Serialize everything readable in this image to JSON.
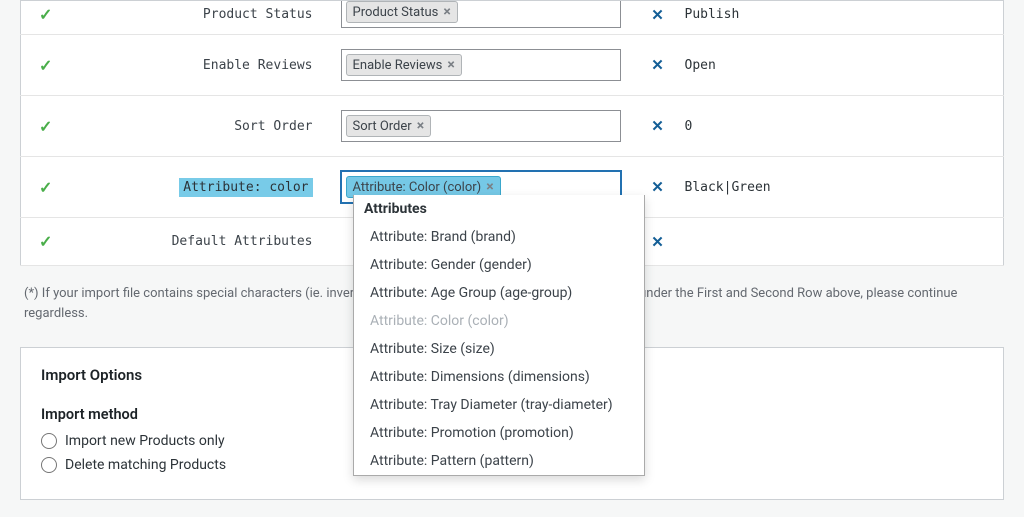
{
  "rows": [
    {
      "label": "Product Status",
      "chip": "Product Status",
      "value": "Publish",
      "highlighted": false,
      "clipped": true
    },
    {
      "label": "Enable Reviews",
      "chip": "Enable Reviews",
      "value": "Open",
      "highlighted": false,
      "clipped": false
    },
    {
      "label": "Sort Order",
      "chip": "Sort Order",
      "value": "0",
      "highlighted": false,
      "clipped": false
    },
    {
      "label": "Attribute: color",
      "chip": "Attribute: Color (color)",
      "value": "Black|Green",
      "highlighted": true,
      "clipped": false
    },
    {
      "label": "Default Attributes",
      "chip": "",
      "value": "",
      "highlighted": false,
      "clipped": false
    }
  ],
  "footer_note": "(*) If your import file contains special characters (ie. inverted commas, exclamation marks) that look weird under the First and Second Row above, please continue regardless.",
  "options": {
    "title": "Import Options",
    "method_title": "Import method",
    "method_options": [
      "Import new Products only",
      "Delete matching Products"
    ]
  },
  "dropdown": {
    "group": "Attributes",
    "items": [
      {
        "label": "Attribute: Brand (brand)",
        "disabled": false
      },
      {
        "label": "Attribute: Gender (gender)",
        "disabled": false
      },
      {
        "label": "Attribute: Age Group (age-group)",
        "disabled": false
      },
      {
        "label": "Attribute: Color (color)",
        "disabled": true
      },
      {
        "label": "Attribute: Size (size)",
        "disabled": false
      },
      {
        "label": "Attribute: Dimensions (dimensions)",
        "disabled": false
      },
      {
        "label": "Attribute: Tray Diameter (tray-diameter)",
        "disabled": false
      },
      {
        "label": "Attribute: Promotion (promotion)",
        "disabled": false
      },
      {
        "label": "Attribute: Pattern (pattern)",
        "disabled": false
      }
    ]
  }
}
